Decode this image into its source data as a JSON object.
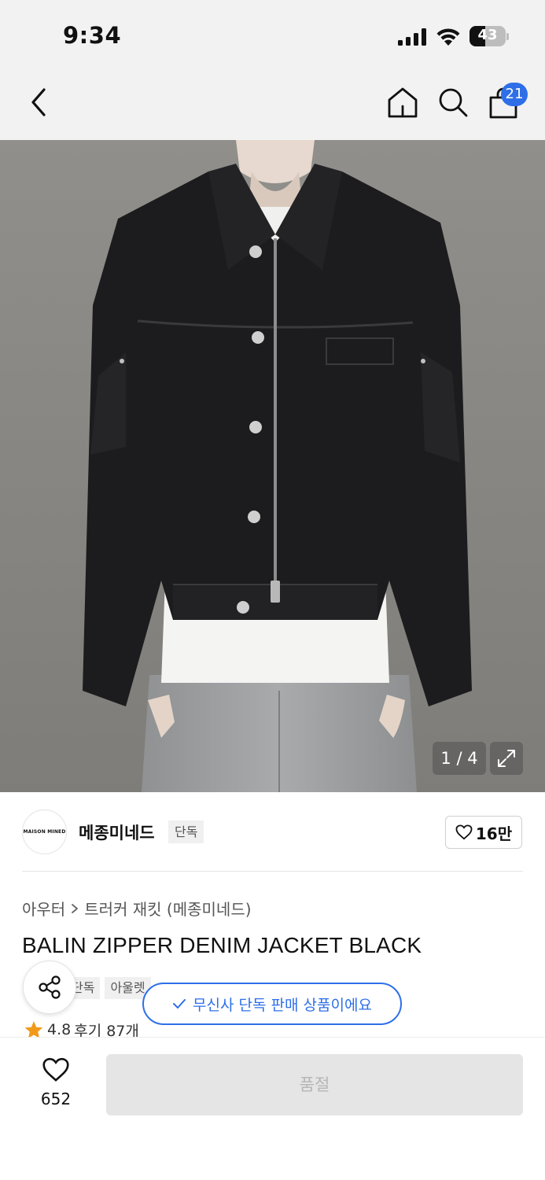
{
  "status_bar": {
    "time": "9:34",
    "battery": "43",
    "battery_level": 0.43,
    "icons": [
      "signal-icon",
      "wifi-icon",
      "battery-icon"
    ]
  },
  "nav": {
    "icons": [
      "back-icon",
      "home-icon",
      "search-icon",
      "cart-icon"
    ],
    "cart_badge": "21",
    "accent_color": "#2e6fe8"
  },
  "gallery": {
    "counter": "1 / 4",
    "current": 1,
    "total": 4
  },
  "brand": {
    "logo_text": "MAISON MINED",
    "name": "메종미네드",
    "tag": "단독",
    "likes": "16만"
  },
  "product": {
    "breadcrumb": [
      "아우터",
      "트러커 재킷 (메종미네드)"
    ],
    "title": "BALIN ZIPPER DENIM JACKET BLACK",
    "tags": [
      "단독",
      "아울렛"
    ],
    "rating": "4.8",
    "reviews": "후기 87개"
  },
  "toast": {
    "text": "무신사 단독 판매 상품이에요"
  },
  "bottom": {
    "likes": "652",
    "buy_button": "품절"
  }
}
